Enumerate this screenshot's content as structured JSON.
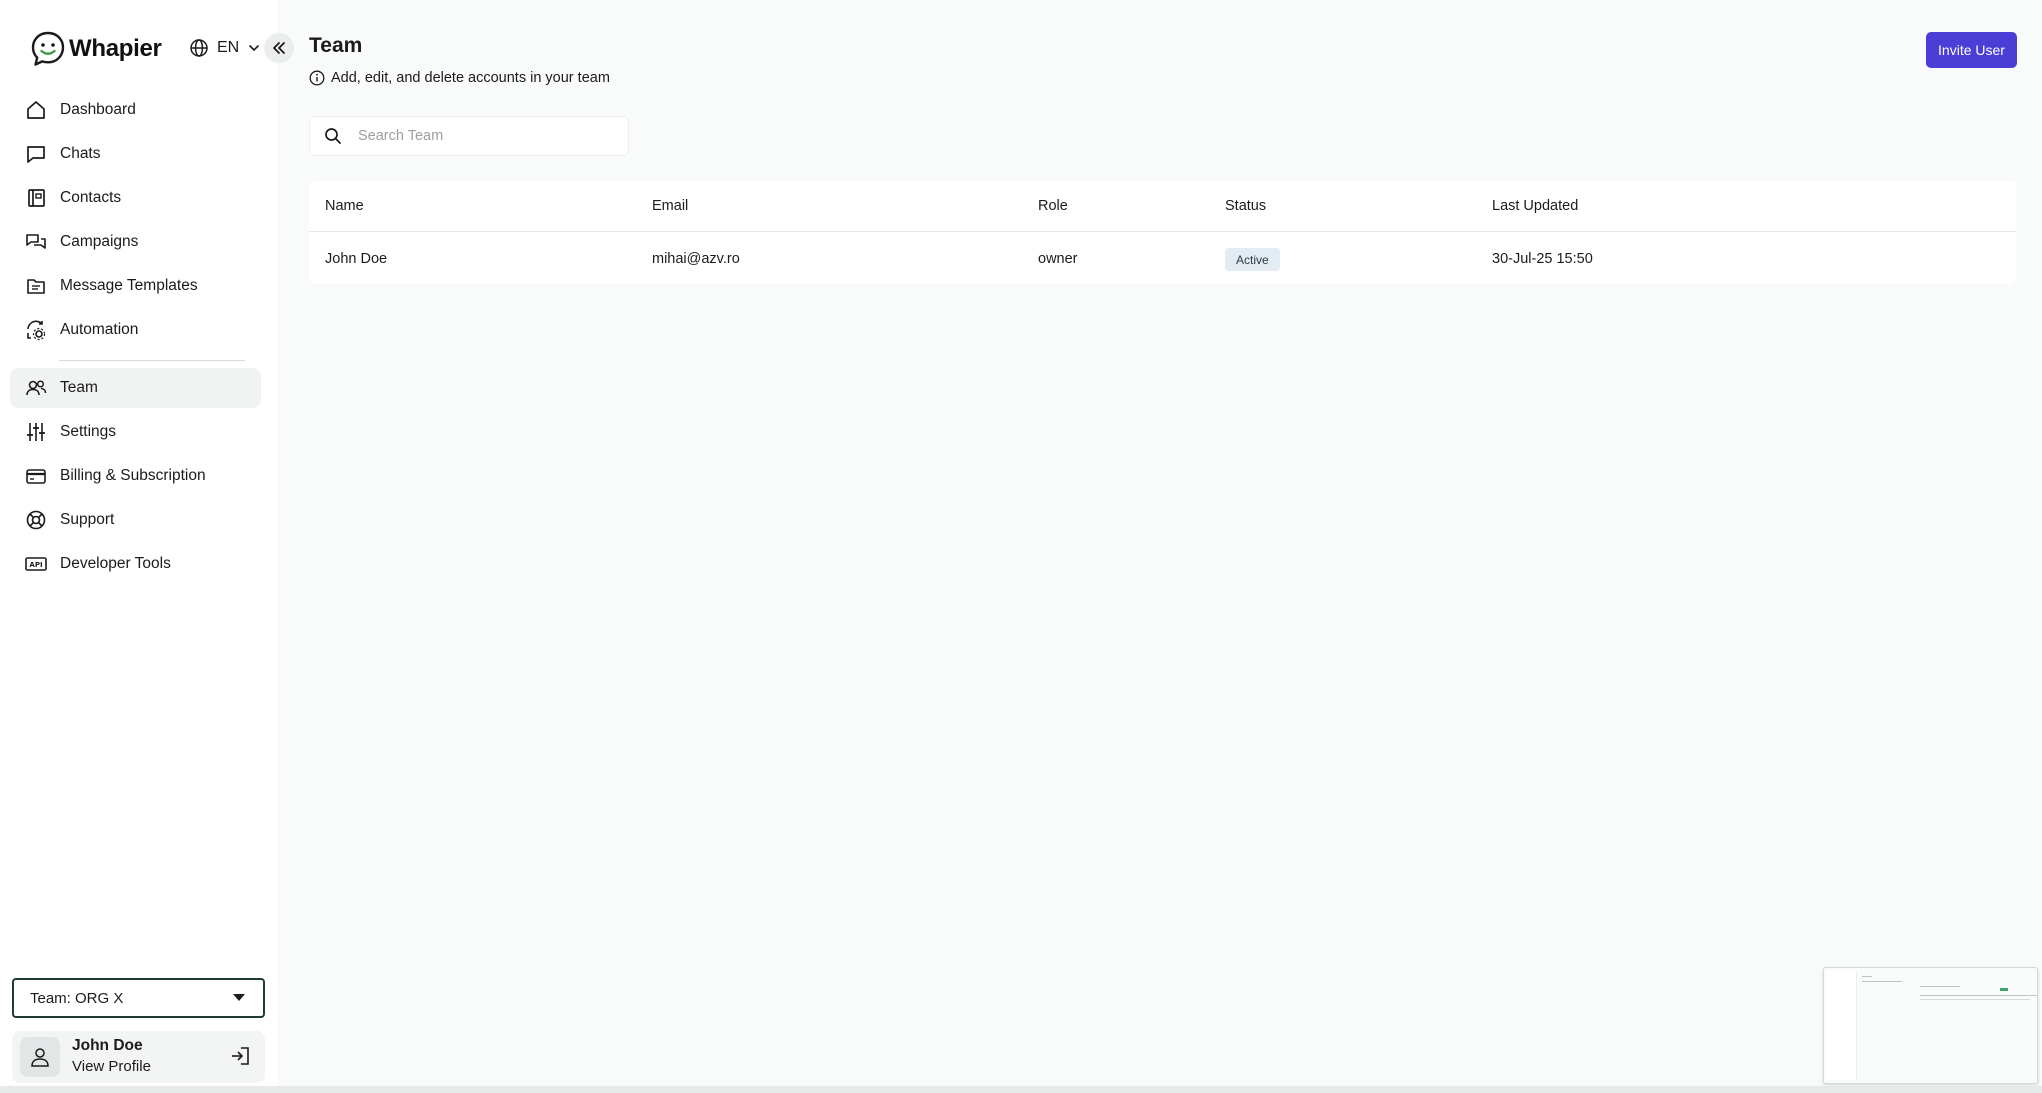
{
  "app": {
    "logo_text": "Whapier",
    "language": "EN"
  },
  "sidebar": {
    "items": [
      {
        "label": "Dashboard",
        "icon": "home-icon"
      },
      {
        "label": "Chats",
        "icon": "chat-bubble-icon"
      },
      {
        "label": "Contacts",
        "icon": "contacts-book-icon"
      },
      {
        "label": "Campaigns",
        "icon": "campaigns-chat-icon"
      },
      {
        "label": "Message Templates",
        "icon": "template-folder-icon"
      },
      {
        "label": "Automation",
        "icon": "automation-cog-icon"
      },
      {
        "label": "Team",
        "icon": "team-users-icon"
      },
      {
        "label": "Settings",
        "icon": "sliders-icon"
      },
      {
        "label": "Billing & Subscription",
        "icon": "credit-card-icon"
      },
      {
        "label": "Support",
        "icon": "lifebuoy-icon"
      },
      {
        "label": "Developer Tools",
        "icon": "api-icon"
      }
    ],
    "active_item": "Team",
    "team_select": "Team: ORG X",
    "profile": {
      "name": "John Doe",
      "link": "View Profile"
    }
  },
  "main": {
    "title": "Team",
    "subtitle": "Add, edit, and delete accounts in your team",
    "invite_button": "Invite User",
    "search_placeholder": "Search Team",
    "table": {
      "columns": [
        "Name",
        "Email",
        "Role",
        "Status",
        "Last Updated"
      ],
      "rows": [
        {
          "name": "John Doe",
          "email": "mihai@azv.ro",
          "role": "owner",
          "status": "Active",
          "last_updated": "30-Jul-25 15:50"
        }
      ]
    }
  },
  "colors": {
    "accent": "#4b3ed6",
    "badge_bg": "#e3ebf3",
    "background": "#f9fafa"
  }
}
